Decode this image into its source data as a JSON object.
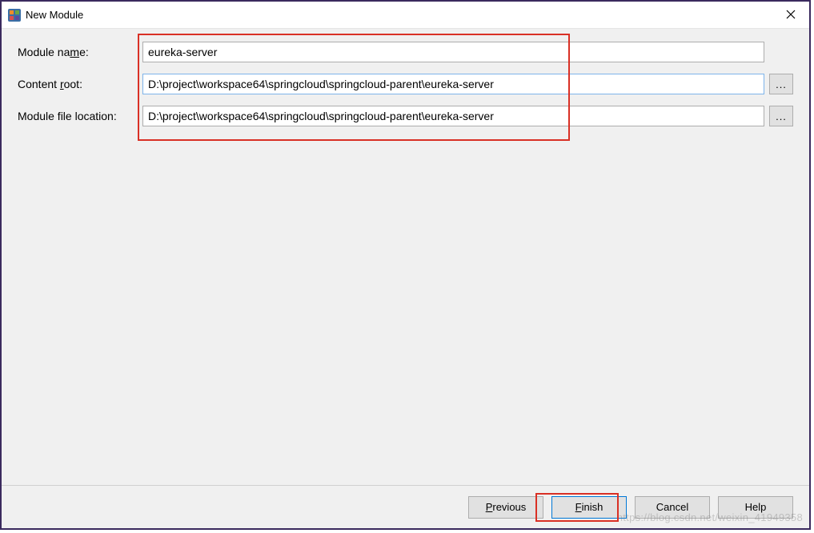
{
  "window": {
    "title": "New Module"
  },
  "form": {
    "module_name_label_pre": "Module na",
    "module_name_label_u": "m",
    "module_name_label_post": "e:",
    "module_name_value": "eureka-server",
    "content_root_label_pre": "Content ",
    "content_root_label_u": "r",
    "content_root_label_post": "oot:",
    "content_root_value": "D:\\project\\workspace64\\springcloud\\springcloud-parent\\eureka-server",
    "module_file_label": "Module file location:",
    "module_file_value": "D:\\project\\workspace64\\springcloud\\springcloud-parent\\eureka-server",
    "browse_label": "..."
  },
  "buttons": {
    "previous_u": "P",
    "previous_rest": "revious",
    "finish_u": "F",
    "finish_rest": "inish",
    "cancel": "Cancel",
    "help": "Help"
  },
  "watermark": "https://blog.csdn.net/weixin_41949358"
}
